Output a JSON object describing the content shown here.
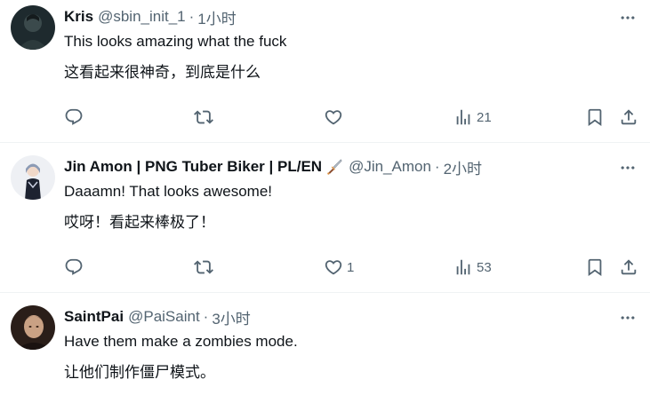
{
  "tweets": [
    {
      "display_name": "Kris",
      "handle": "@sbin_init_1",
      "separator": "·",
      "time": "1小时",
      "lines": [
        "This looks amazing what the fuck",
        "这看起来很神奇，到底是什么"
      ],
      "counts": {
        "reply": "",
        "retweet": "",
        "like": "",
        "views": "21"
      }
    },
    {
      "display_name": "Jin Amon | PNG Tuber Biker | PL/EN",
      "handle": "@Jin_Amon",
      "separator": "·",
      "time": "2小时",
      "name_emoji": "sword-emoji",
      "lines": [
        "Daaamn! That looks awesome!",
        "哎呀！看起来棒极了！"
      ],
      "counts": {
        "reply": "",
        "retweet": "",
        "like": "1",
        "views": "53"
      }
    },
    {
      "display_name": "SaintPai",
      "handle": "@PaiSaint",
      "separator": "·",
      "time": "3小时",
      "lines": [
        "Have them make a zombies mode.",
        "让他们制作僵尸模式。"
      ],
      "counts": {}
    }
  ],
  "icons": {
    "reply": "reply-icon",
    "retweet": "retweet-icon",
    "like": "heart-icon",
    "views": "views-icon",
    "bookmark": "bookmark-icon",
    "share": "share-icon",
    "more": "more-icon"
  },
  "colors": {
    "text": "#0f1419",
    "secondary": "#536471",
    "divider": "#eff3f4"
  }
}
